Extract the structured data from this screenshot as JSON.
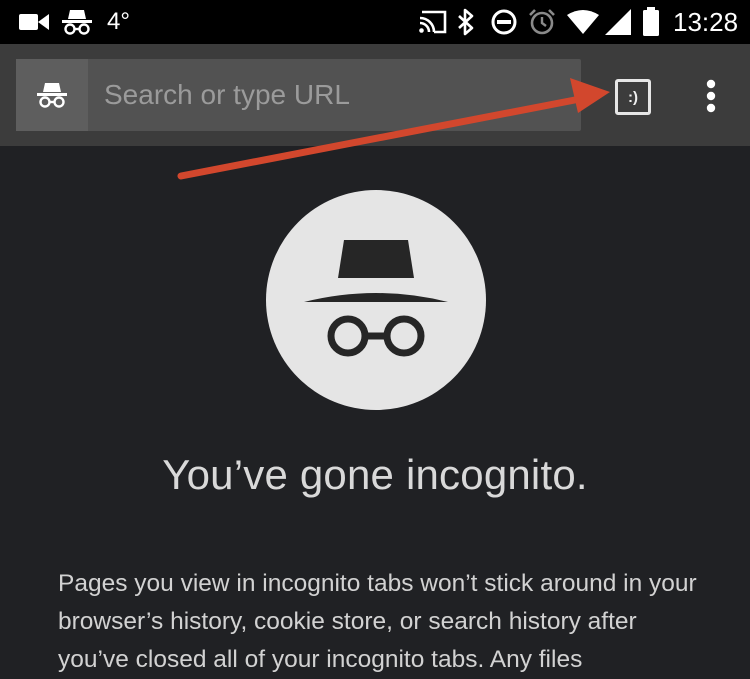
{
  "status_bar": {
    "temperature": "4°",
    "time": "13:28",
    "icons": [
      "video-camera-icon",
      "incognito-icon",
      "cast-icon",
      "bluetooth-icon",
      "do-not-disturb-icon",
      "alarm-icon",
      "wifi-icon",
      "cell-signal-icon",
      "battery-icon"
    ]
  },
  "toolbar": {
    "search_placeholder": "Search or type URL",
    "tabs_label": ":)",
    "icons": [
      "incognito-icon",
      "more-vert-icon"
    ]
  },
  "annotation": {
    "arrow_color": "#d2472d"
  },
  "content": {
    "headline": "You’ve gone incognito.",
    "body": "Pages you view in incognito tabs won’t stick around in your browser’s history, cookie store, or search history after you’ve closed all of your incognito tabs. Any files"
  },
  "colors": {
    "background": "#202124",
    "toolbar": "#3c3c3c",
    "omnibox": "#525252",
    "circle": "#e5e5e5"
  }
}
